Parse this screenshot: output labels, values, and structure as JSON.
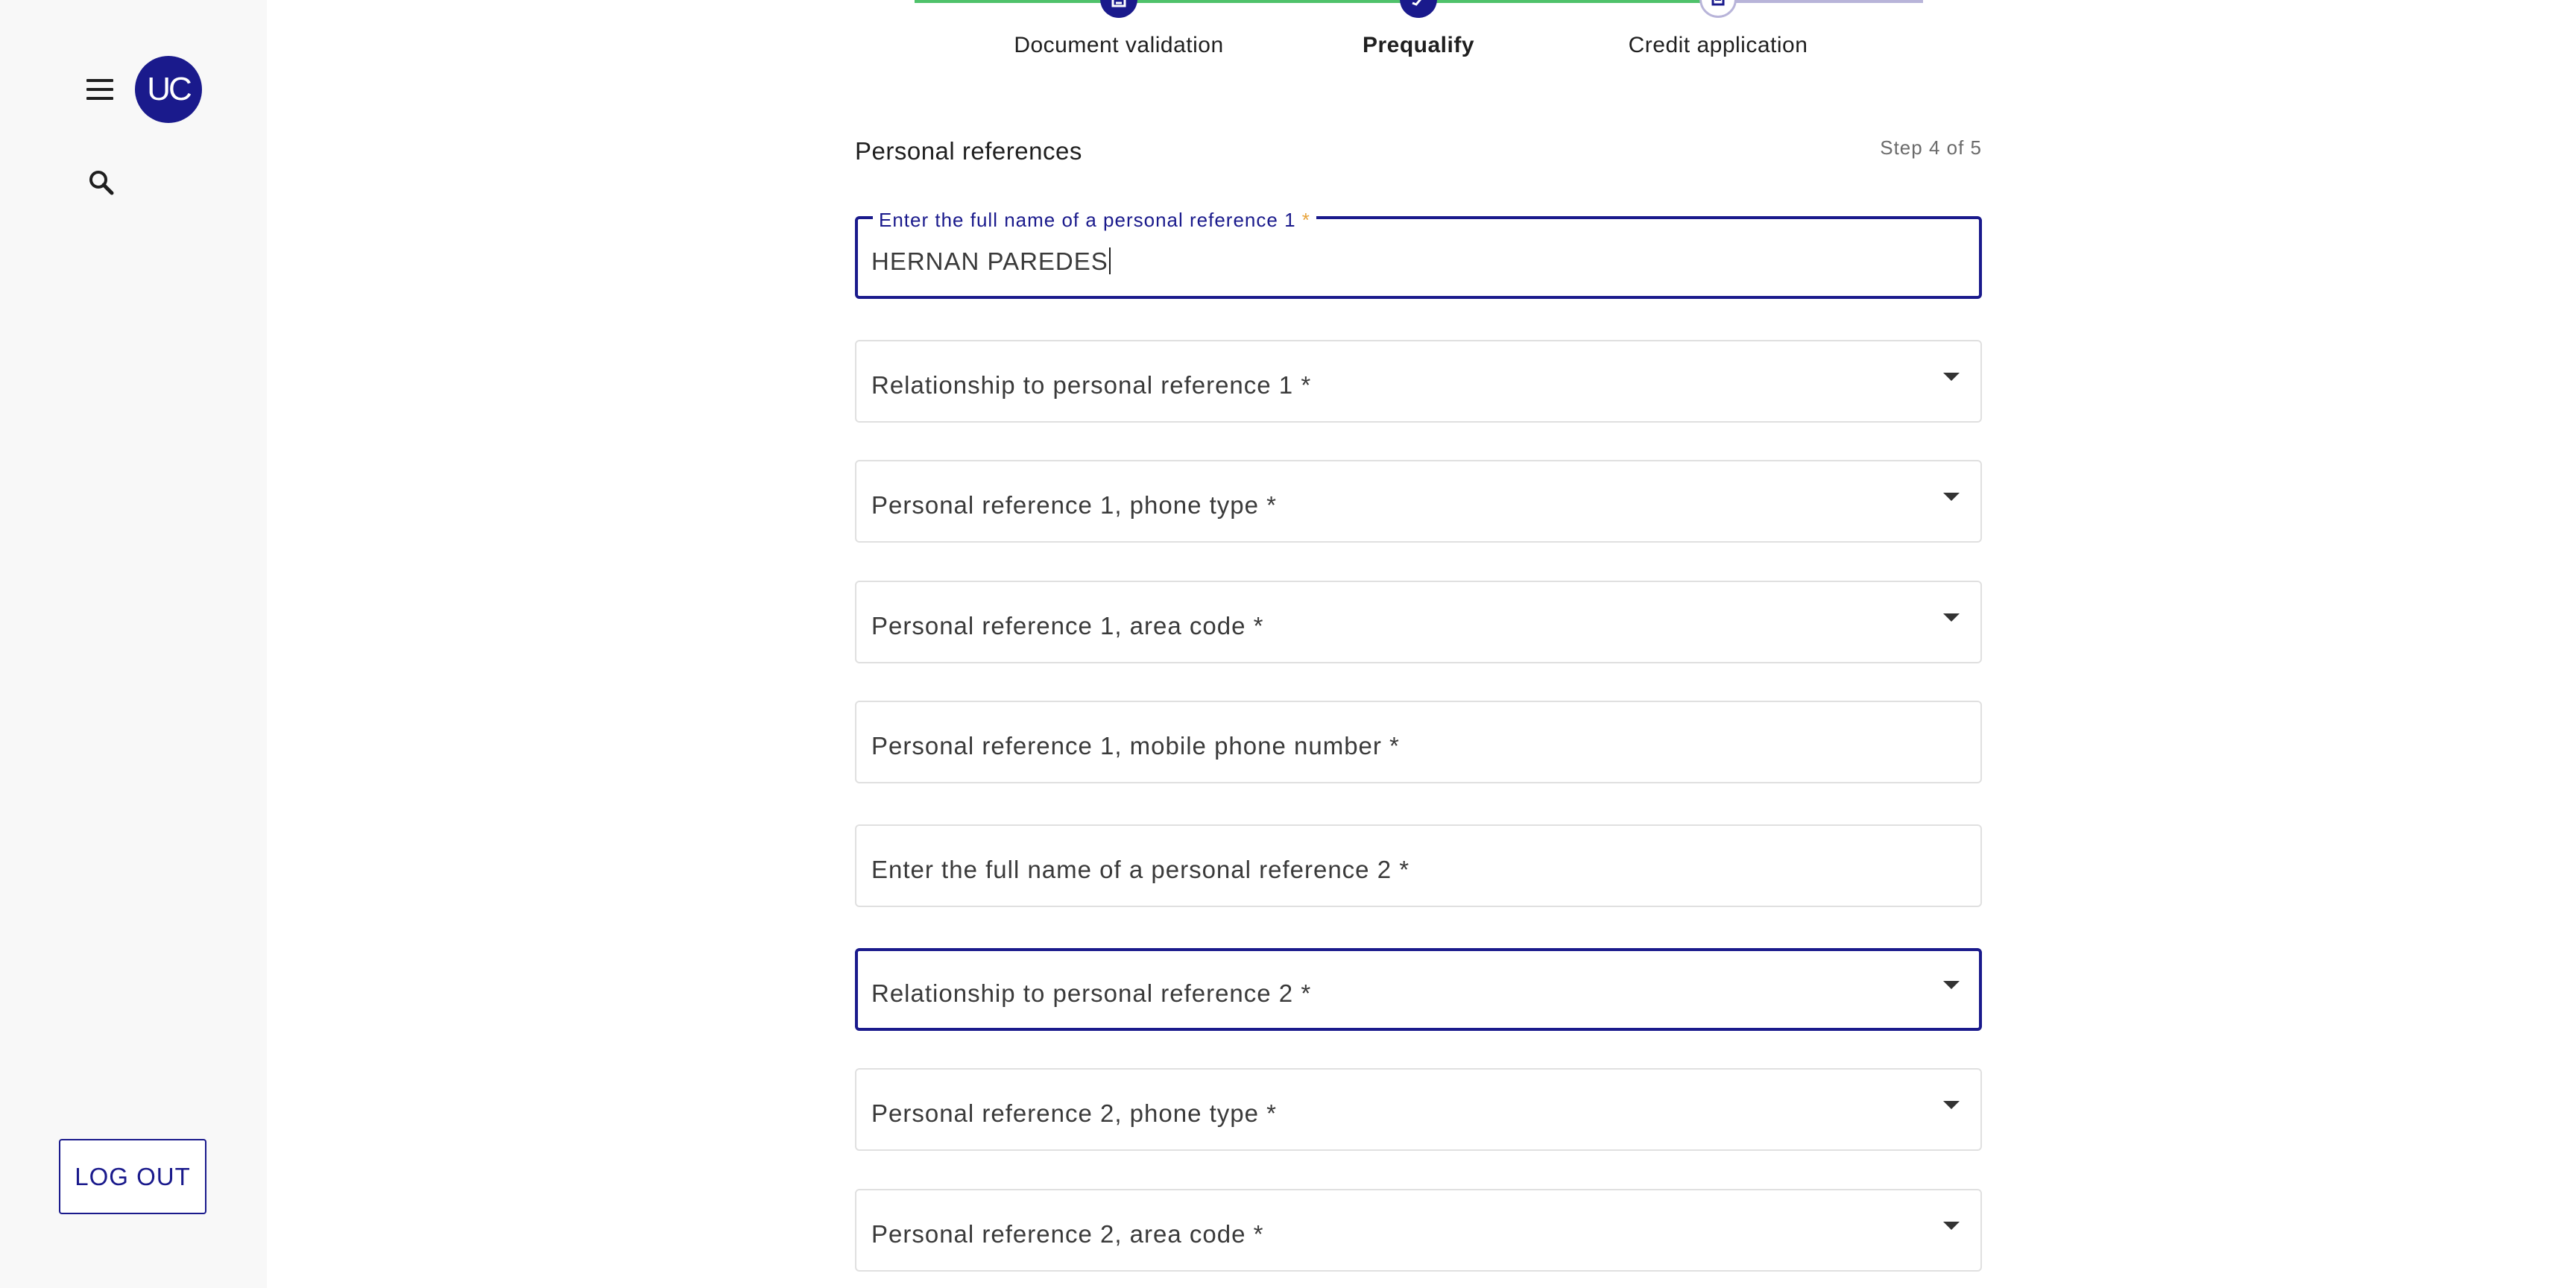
{
  "sidebar": {
    "avatar_initials": "UC",
    "logout_label": "LOG OUT",
    "menu_icon": "hamburger-menu-icon",
    "search_icon": "search-icon"
  },
  "stepper": {
    "steps": [
      {
        "label": "Document validation",
        "state": "completed"
      },
      {
        "label": "Prequalify",
        "state": "active"
      },
      {
        "label": "Credit application",
        "state": "pending"
      }
    ],
    "colors": {
      "completed_line": "#4fc26b",
      "pending_line": "#b8b4d9",
      "accent": "#1a1a8c"
    }
  },
  "form": {
    "section_title": "Personal references",
    "step_counter": "Step 4 of 5",
    "fields": [
      {
        "label": "Enter the full name of a personal reference 1",
        "required_mark": "*",
        "value": "HERNAN PAREDES",
        "type": "text",
        "focused": true
      },
      {
        "label": "Relationship to personal reference 1 *",
        "type": "select"
      },
      {
        "label": "Personal reference 1, phone type *",
        "type": "select"
      },
      {
        "label": "Personal reference 1, area code *",
        "type": "select"
      },
      {
        "label": "Personal reference 1, mobile phone number *",
        "type": "text"
      },
      {
        "label": "Enter the full name of a personal reference 2 *",
        "type": "text"
      },
      {
        "label": "Relationship to personal reference 2 *",
        "type": "select",
        "focused": true
      },
      {
        "label": "Personal reference 2, phone type *",
        "type": "select"
      },
      {
        "label": "Personal reference 2, area code *",
        "type": "select"
      }
    ]
  }
}
